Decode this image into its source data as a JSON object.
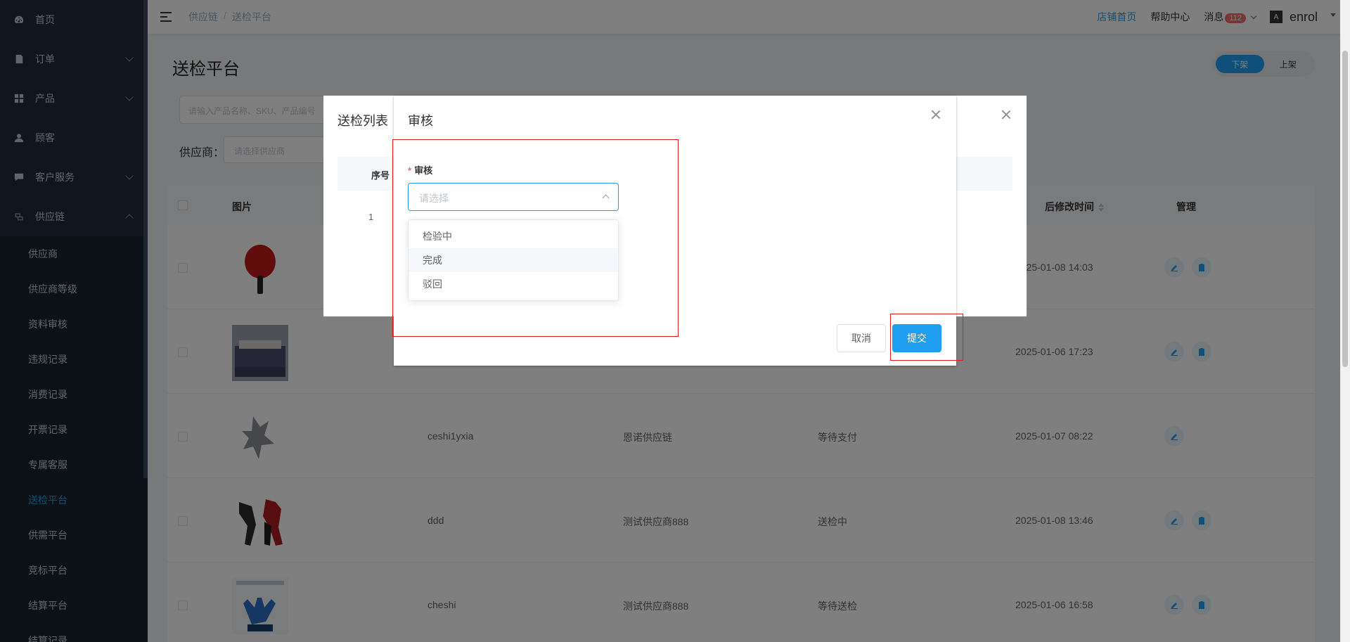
{
  "sidebar": {
    "items": [
      {
        "label": "首页",
        "icon": "dashboard-icon",
        "expand": ""
      },
      {
        "label": "订单",
        "icon": "order-icon",
        "expand": "down"
      },
      {
        "label": "产品",
        "icon": "grid-icon",
        "expand": "down"
      },
      {
        "label": "顾客",
        "icon": "user-icon",
        "expand": ""
      },
      {
        "label": "客户服务",
        "icon": "chat-icon",
        "expand": "down"
      },
      {
        "label": "供应链",
        "icon": "chain-icon",
        "expand": "up"
      }
    ],
    "sub_items": [
      "供应商",
      "供应商等级",
      "资料审核",
      "违规记录",
      "消费记录",
      "开票记录",
      "专属客服",
      "送检平台",
      "供需平台",
      "竞标平台",
      "结算平台",
      "结算记录"
    ],
    "active_sub": "送检平台"
  },
  "topbar": {
    "breadcrumb": [
      "供应链",
      "送检平台"
    ],
    "shop_home": "店铺首页",
    "help": "帮助中心",
    "messages": "消息",
    "message_count": "112",
    "avatar_text": "A",
    "username": "enrol"
  },
  "page": {
    "title": "送检平台",
    "toggle_off": "下架",
    "toggle_on": "上架",
    "search_placeholder": "请输入产品名称、SKU、产品编号",
    "supplier_label": "供应商：",
    "supplier_placeholder": "请选择供应商"
  },
  "table": {
    "headers": {
      "image": "图片",
      "modified": "后修改时间",
      "manage": "管理"
    },
    "rows": [
      {
        "name": "",
        "supplier": "",
        "status": "",
        "time": "2025-01-08 14:03",
        "img": "paddle"
      },
      {
        "name": "",
        "supplier": "",
        "status": "",
        "time": "2025-01-06 17:23",
        "img": "bed"
      },
      {
        "name": "ceshi1yxia",
        "supplier": "恩诺供应链",
        "status": "等待支付",
        "time": "2025-01-07 08:22",
        "img": "figure"
      },
      {
        "name": "ddd",
        "supplier": "测试供应商888",
        "status": "送检中",
        "time": "2025-01-08 13:46",
        "img": "legs"
      },
      {
        "name": "cheshi",
        "supplier": "测试供应商888",
        "status": "等待送检",
        "time": "2025-01-06 16:58",
        "img": "gloves"
      }
    ]
  },
  "list_dialog": {
    "title": "送检列表",
    "col_index": "序号",
    "row_index": "1"
  },
  "review_dialog": {
    "title": "审核",
    "field_label": "审核",
    "required_mark": "*",
    "select_placeholder": "请选择",
    "options": [
      "检验中",
      "完成",
      "驳回"
    ],
    "hover_option": "完成",
    "cancel": "取消",
    "submit": "提交"
  },
  "colors": {
    "accent": "#1e9ff2",
    "sidebar": "#1f2d3d",
    "highlight": "#e02020"
  }
}
